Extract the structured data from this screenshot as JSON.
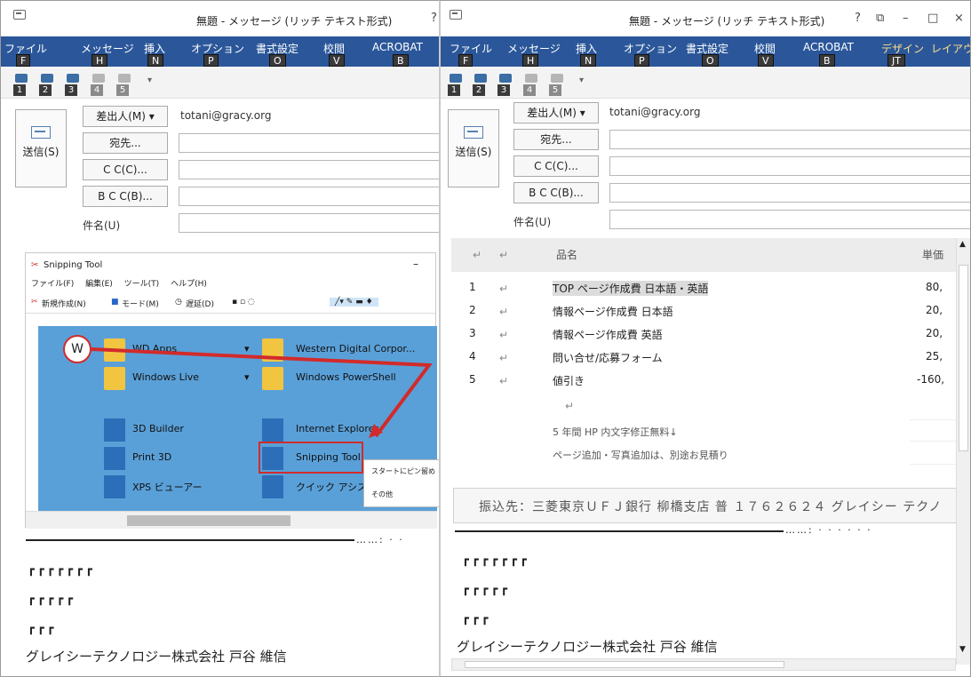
{
  "left": {
    "title": "無題 - メッセージ (リッチ テキスト形式)",
    "title_right": "?",
    "tabs": [
      {
        "label": "ファイル",
        "key": "F"
      },
      {
        "label": "メッセージ",
        "key": "H"
      },
      {
        "label": "挿入",
        "key": "N"
      },
      {
        "label": "オプション",
        "key": "P"
      },
      {
        "label": "書式設定",
        "key": "O"
      },
      {
        "label": "校閲",
        "key": "V"
      },
      {
        "label": "ACROBAT",
        "key": "B"
      }
    ],
    "qat_keys": [
      "1",
      "2",
      "3",
      "4",
      "5"
    ],
    "send_label": "送信(S)",
    "from_label": "差出人(M) ▾",
    "from_value": "totani@gracy.org",
    "to_label": "宛先...",
    "cc_label": "C C(C)...",
    "bcc_label": "B C C(B)...",
    "subject_label": "件名(U)",
    "snip": {
      "title": "Snipping Tool",
      "minimize": "–",
      "menu": [
        "ファイル(F)",
        "編集(E)",
        "ツール(T)",
        "ヘルプ(H)"
      ],
      "toolbar": [
        "新規作成(N)",
        "モード(M)",
        "遅延(D)"
      ],
      "w_letter": "W",
      "apps": [
        "WD Apps",
        "Western Digital Corpor...",
        "Windows Live",
        "Windows PowerShell",
        "3D Builder",
        "Internet Explorer",
        "Print 3D",
        "Snipping Tool",
        "XPS ビューアー",
        "クイック アシスト"
      ],
      "ctx_menu": [
        "スタートにピン留め",
        "その他"
      ]
    },
    "dots": "……: · ·",
    "sig_lines": [
      "┏┏┏┏┏┏┏",
      "┏┏┏┏┏",
      "┏┏┏"
    ],
    "company": "グレイシーテクノロジー株式会社 戸谷 維信"
  },
  "right": {
    "title": "無題 - メッセージ (リッチ テキスト形式)",
    "controls": [
      "?",
      "⧉",
      "–",
      "□",
      "×"
    ],
    "tabs": [
      {
        "label": "ファイル",
        "key": "F"
      },
      {
        "label": "メッセージ",
        "key": "H"
      },
      {
        "label": "挿入",
        "key": "N"
      },
      {
        "label": "オプション",
        "key": "P"
      },
      {
        "label": "書式設定",
        "key": "O"
      },
      {
        "label": "校閲",
        "key": "V"
      },
      {
        "label": "ACROBAT",
        "key": "B"
      },
      {
        "label": "デザイン",
        "key": "JT"
      },
      {
        "label": "レイアウ",
        "key": ""
      }
    ],
    "qat_keys": [
      "1",
      "2",
      "3",
      "4",
      "5"
    ],
    "send_label": "送信(S)",
    "from_label": "差出人(M) ▾",
    "from_value": "totani@gracy.org",
    "to_label": "宛先...",
    "cc_label": "C C(C)...",
    "bcc_label": "B C C(B)...",
    "subject_label": "件名(U)",
    "table": {
      "header_name": "品名",
      "header_price": "単価",
      "rows": [
        {
          "no": "1",
          "name": "TOP ページ作成費 日本語・英語",
          "price": "80,"
        },
        {
          "no": "2",
          "name": "情報ページ作成費 日本語",
          "price": "20,"
        },
        {
          "no": "3",
          "name": "情報ページ作成費 英語",
          "price": "20,"
        },
        {
          "no": "4",
          "name": "問い合せ/応募フォーム",
          "price": "25,"
        },
        {
          "no": "5",
          "name": "値引き",
          "price": "-160,"
        }
      ],
      "note1": "5 年間 HP 内文字修正無料↓",
      "note2": "ページ追加・写真追加は、別途お見積り"
    },
    "bank": "振込先：三菱東京ＵＦＪ銀行 柳橋支店 普 １７６２６２４ グレイシー テクノ",
    "dots": "……: · ·  ·  ·  · ·",
    "sig_lines": [
      "┏┏┏┏┏┏┏",
      "┏┏┏┏┏",
      "┏┏┏"
    ],
    "company": "グレイシーテクノロジー株式会社 戸谷 維信"
  }
}
